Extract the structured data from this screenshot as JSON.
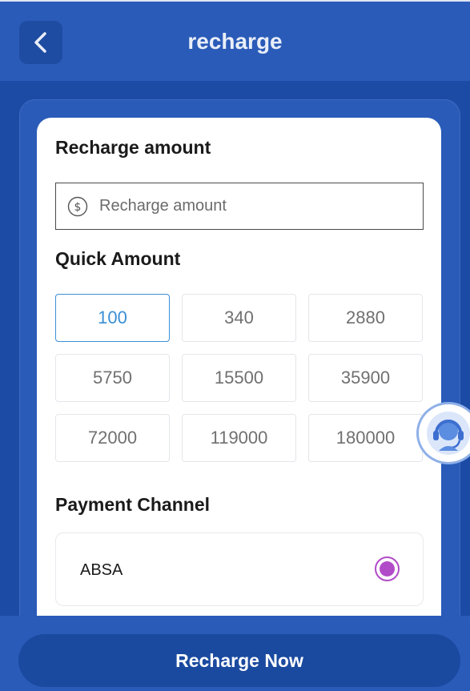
{
  "header": {
    "title": "recharge",
    "back_icon": "chevron-left-icon"
  },
  "amount": {
    "label": "Recharge amount",
    "input_placeholder": "Recharge amount",
    "input_value": "",
    "icon": "dollar-circle-icon"
  },
  "quick": {
    "label": "Quick Amount",
    "options": [
      "100",
      "340",
      "2880",
      "5750",
      "15500",
      "35900",
      "72000",
      "119000",
      "180000"
    ],
    "selected": "100"
  },
  "payment": {
    "label": "Payment Channel",
    "channels": [
      {
        "name": "ABSA",
        "selected": true
      }
    ]
  },
  "support": {
    "icon": "customer-support-icon"
  },
  "footer": {
    "button_label": "Recharge Now"
  },
  "colors": {
    "primary": "#2a5bb8",
    "dark_primary": "#1a4aa0",
    "selected_amount": "#3a8fd6",
    "radio_accent": "#b14cc8"
  }
}
